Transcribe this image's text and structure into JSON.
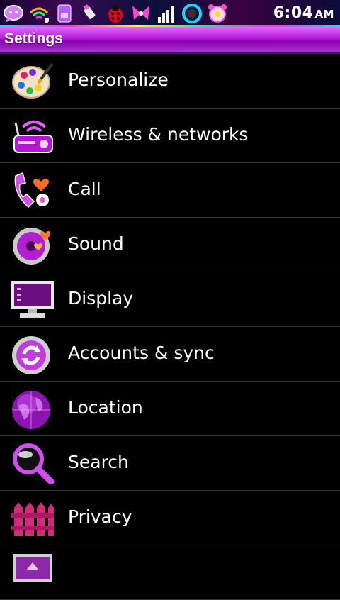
{
  "status_bar": {
    "time": "6:04",
    "ampm": "AM",
    "icons": [
      "sms-bubble-icon",
      "wifi-icon",
      "sim-card-icon",
      "usb-icon",
      "ladybug-icon",
      "butterfly-icon",
      "signal-bars-icon",
      "sync-circle-icon",
      "alarm-clock-icon"
    ]
  },
  "header": {
    "title": "Settings"
  },
  "settings": {
    "items": [
      {
        "label": "Personalize",
        "icon": "palette-icon"
      },
      {
        "label": "Wireless & networks",
        "icon": "radio-router-icon"
      },
      {
        "label": "Call",
        "icon": "phone-heart-icon"
      },
      {
        "label": "Sound",
        "icon": "speaker-disc-icon"
      },
      {
        "label": "Display",
        "icon": "monitor-icon"
      },
      {
        "label": "Accounts & sync",
        "icon": "sync-badge-icon"
      },
      {
        "label": "Location",
        "icon": "globe-icon"
      },
      {
        "label": "Search",
        "icon": "magnifier-icon"
      },
      {
        "label": "Privacy",
        "icon": "fence-icon"
      },
      {
        "label": "",
        "icon": "partial-item-icon"
      }
    ]
  },
  "colors": {
    "accent": "#b21bd8",
    "background": "#000000",
    "divider": "#333333",
    "text": "#ffffff"
  }
}
